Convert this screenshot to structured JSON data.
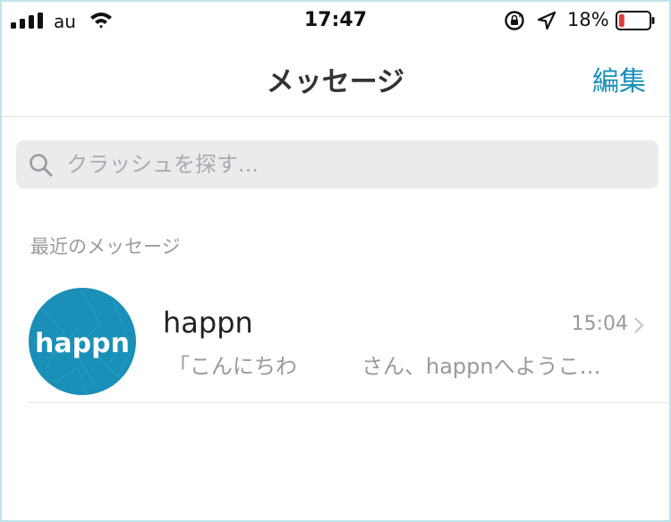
{
  "status_bar": {
    "carrier": "au",
    "time": "17:47",
    "battery_percent": "18%",
    "battery_level": 0.18,
    "battery_color": "#e53935"
  },
  "nav": {
    "title": "メッセージ",
    "edit_label": "編集",
    "accent": "#1a8fb7"
  },
  "search": {
    "placeholder": "クラッシュを探す..."
  },
  "section": {
    "title": "最近のメッセージ"
  },
  "conversations": [
    {
      "name": "happn",
      "time": "15:04",
      "preview_start": "「こんにちわ",
      "preview_end": "さん、happnへようこ…",
      "avatar_text": "happn",
      "avatar_color": "#1a8fb7"
    }
  ]
}
